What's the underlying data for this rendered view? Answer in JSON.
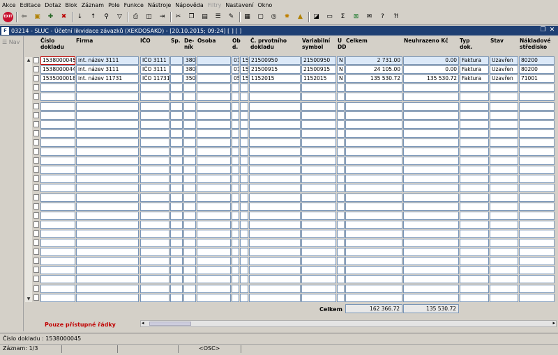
{
  "menu": [
    "Akce",
    "Editace",
    "Dotaz",
    "Blok",
    "Záznam",
    "Pole",
    "Funkce",
    "Nástroje",
    "Nápověda",
    "Filtry",
    "Nastavení",
    "Okno"
  ],
  "toolbar": {
    "exit_label": "EXIT"
  },
  "window": {
    "logo": "F",
    "title": "03214 - SLUC - Účetní likvidace závazků (XEKDOSAKO) - [20.10.2015; 09:24]  [ ] [ ]"
  },
  "nav": {
    "label": "Nav"
  },
  "columns": {
    "cislo": "Číslo\ndokladu",
    "firma": "Firma",
    "ico": "IČO",
    "sp": "Sp.",
    "denik": "De-\nník",
    "osoba": "Osoba",
    "obd": "Ob\nd.",
    "prvotni": "Č. prvotního\ndokladu",
    "vs": "Variabilní\nsymbol",
    "udd": "U\nDD",
    "celkem": "Celkem",
    "neuhrazeno": "Neuhrazeno Kč",
    "typ": "Typ\ndok.",
    "stav": "Stav",
    "stredisko": "Nákladové\nstředisko"
  },
  "rows": [
    {
      "cislo": "1538000045",
      "firma": "int. název 3111",
      "ico": "IČO 3111",
      "sp": "",
      "denik": "380",
      "osoba": "",
      "ob": "01",
      "d": "15",
      "prvotni": "21500950",
      "vs": "21500950",
      "udd": "N",
      "celkem": "2 731.00",
      "neuhrazeno": "0.00",
      "typ": "Faktura",
      "stav": "Uzavřen",
      "stredisko": "80200"
    },
    {
      "cislo": "1538000044",
      "firma": "int. název 3111",
      "ico": "IČO 3111",
      "sp": "",
      "denik": "380",
      "osoba": "",
      "ob": "01",
      "d": "15",
      "prvotni": "21500915",
      "vs": "21500915",
      "udd": "N",
      "celkem": "24 105.00",
      "neuhrazeno": "0.00",
      "typ": "Faktura",
      "stav": "Uzavřen",
      "stredisko": "80200"
    },
    {
      "cislo": "1535000018",
      "firma": "int. název 11731",
      "ico": "IČO 11731",
      "sp": "",
      "denik": "350",
      "osoba": "",
      "ob": "05",
      "d": "15",
      "prvotni": "1152015",
      "vs": "1152015",
      "udd": "N",
      "celkem": "135 530.72",
      "neuhrazeno": "135 530.72",
      "typ": "Faktura",
      "stav": "Uzavřen",
      "stredisko": "71001"
    }
  ],
  "totals": {
    "label": "Celkem",
    "celkem": "162 366.72",
    "neuhrazeno": "135 530.72"
  },
  "restrict_label": "Pouze přístupné řádky",
  "status": {
    "field": "Číslo dokladu : 1538000045",
    "record": "Záznam: 1/3",
    "osc": "<OSC>"
  }
}
